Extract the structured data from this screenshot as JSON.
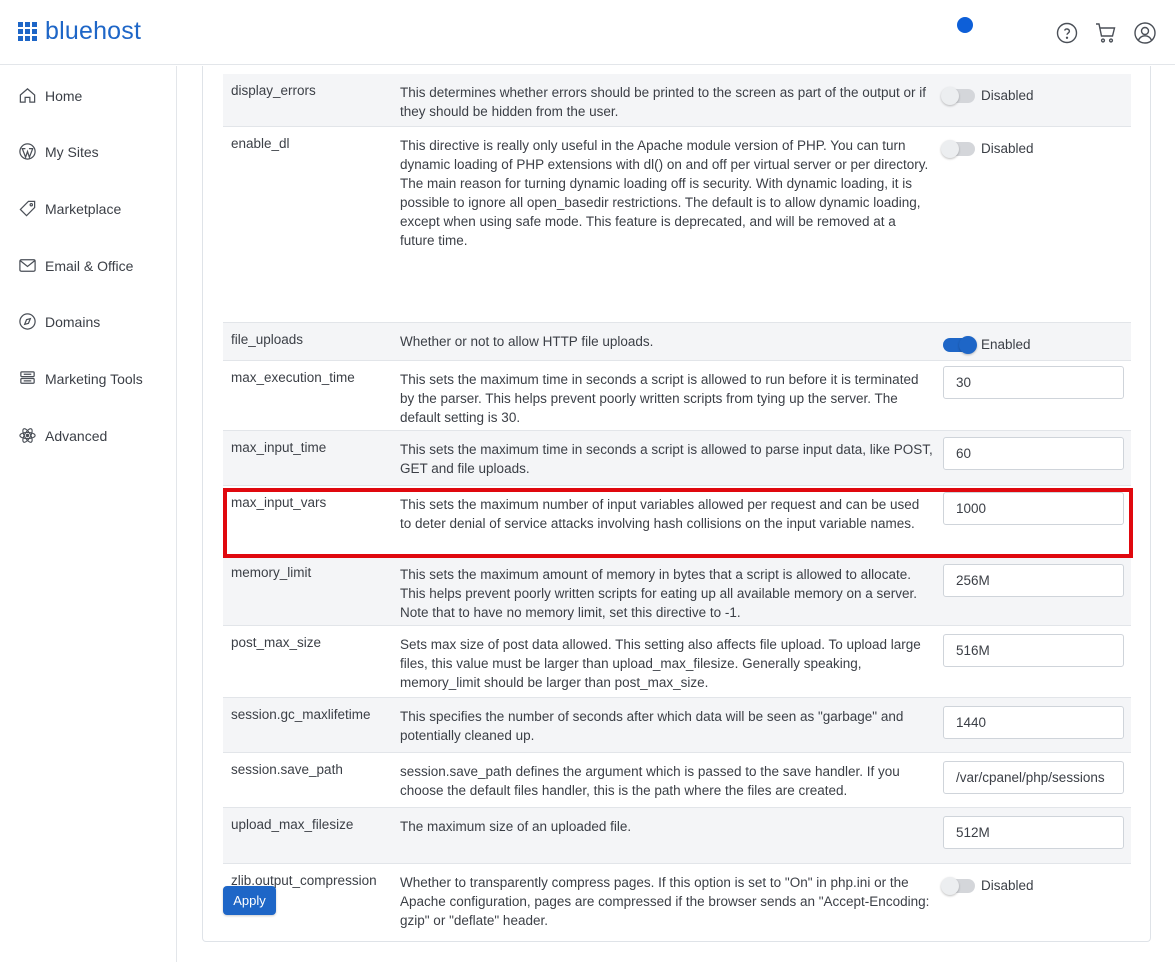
{
  "brand": {
    "name": "bluehost",
    "color": "#1e66c7"
  },
  "header": {
    "icons": [
      "help-icon",
      "cart-icon",
      "user-icon"
    ]
  },
  "sidebar": {
    "items": [
      {
        "label": "Home",
        "icon": "home-icon"
      },
      {
        "label": "My Sites",
        "icon": "wordpress-icon"
      },
      {
        "label": "Marketplace",
        "icon": "tag-icon"
      },
      {
        "label": "Email & Office",
        "icon": "mail-icon"
      },
      {
        "label": "Domains",
        "icon": "compass-icon"
      },
      {
        "label": "Marketing Tools",
        "icon": "marketing-icon"
      },
      {
        "label": "Advanced",
        "icon": "atom-icon"
      }
    ]
  },
  "directives": [
    {
      "name": "display_errors",
      "description": "This determines whether errors should be printed to the screen as part of the output or if they should be hidden from the user.",
      "type": "toggle",
      "enabled": false,
      "value": "Disabled"
    },
    {
      "name": "enable_dl",
      "description": "This directive is really only useful in the Apache module version of PHP. You can turn dynamic loading of PHP extensions with dl() on and off per virtual server or per directory. The main reason for turning dynamic loading off is security. With dynamic loading, it is possible to ignore all open_basedir restrictions. The default is to allow dynamic loading, except when using safe mode. This feature is deprecated, and will be removed at a future time.",
      "type": "toggle",
      "enabled": false,
      "value": "Disabled"
    },
    {
      "name": "file_uploads",
      "description": "Whether or not to allow HTTP file uploads.",
      "type": "toggle",
      "enabled": true,
      "value": "Enabled"
    },
    {
      "name": "max_execution_time",
      "description": "This sets the maximum time in seconds a script is allowed to run before it is terminated by the parser. This helps prevent poorly written scripts from tying up the server. The default setting is 30.",
      "type": "input",
      "value": "30"
    },
    {
      "name": "max_input_time",
      "description": "This sets the maximum time in seconds a script is allowed to parse input data, like POST, GET and file uploads.",
      "type": "input",
      "value": "60"
    },
    {
      "name": "max_input_vars",
      "description": "This sets the maximum number of input variables allowed per request and can be used to deter denial of service attacks involving hash collisions on the input variable names.",
      "type": "input",
      "value": "1000"
    },
    {
      "name": "memory_limit",
      "description": "This sets the maximum amount of memory in bytes that a script is allowed to allocate. This helps prevent poorly written scripts for eating up all available memory on a server. Note that to have no memory limit, set this directive to -1.",
      "type": "input",
      "value": "256M",
      "highlighted": true
    },
    {
      "name": "post_max_size",
      "description": "Sets max size of post data allowed. This setting also affects file upload. To upload large files, this value must be larger than upload_max_filesize. Generally speaking, memory_limit should be larger than post_max_size.",
      "type": "input",
      "value": "516M"
    },
    {
      "name": "session.gc_maxlifetime",
      "description": "This specifies the number of seconds after which data will be seen as \"garbage\" and potentially cleaned up.",
      "type": "input",
      "value": "1440"
    },
    {
      "name": "session.save_path",
      "description": "session.save_path defines the argument which is passed to the save handler. If you choose the default files handler, this is the path where the files are created.",
      "type": "input",
      "value": "/var/cpanel/php/sessions"
    },
    {
      "name": "upload_max_filesize",
      "description": "The maximum size of an uploaded file.",
      "type": "input",
      "value": "512M"
    },
    {
      "name": "zlib.output_compression",
      "description": "Whether to transparently compress pages. If this option is set to \"On\" in php.ini or the Apache configuration, pages are compressed if the browser sends an \"Accept-Encoding: gzip\" or \"deflate\" header.",
      "type": "toggle",
      "enabled": false,
      "value": "Disabled"
    }
  ],
  "apply_label": "Apply",
  "highlight_color": "#e0080e"
}
